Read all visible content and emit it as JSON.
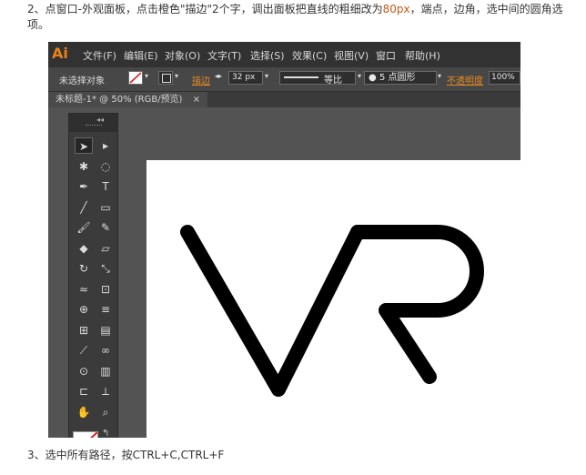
{
  "step1": {
    "text_a": "2、点窗口-外观面板，点击橙色\"描边\"2个字，调出面板把直线的粗细改为",
    "highlight": "80px",
    "text_b": "，端点，边角，选中间的圆角选项。"
  },
  "menubar": {
    "logo": "Ai",
    "items": [
      "文件(F)",
      "编辑(E)",
      "对象(O)",
      "文字(T)",
      "选择(S)",
      "效果(C)",
      "视图(V)",
      "窗口",
      "帮助(H)"
    ]
  },
  "controlbar": {
    "selection_label": "未选择对象",
    "stroke_label": "描边",
    "stroke_weight": "32 px",
    "profile_label": "等比",
    "brush_label": "5 点圆形",
    "opacity_label": "不透明度",
    "opacity_value": "100%"
  },
  "tab": {
    "title": "未标题-1* @ 50% (RGB/预览)",
    "close": "×"
  },
  "tools": [
    "selection-tool",
    "direct-selection-tool",
    "magic-wand-tool",
    "lasso-tool",
    "pen-tool",
    "type-tool",
    "line-tool",
    "rectangle-tool",
    "paintbrush-tool",
    "pencil-tool",
    "blob-brush-tool",
    "eraser-tool",
    "rotate-tool",
    "scale-tool",
    "warp-tool",
    "free-transform-tool",
    "shape-builder-tool",
    "graph-tool",
    "mesh-tool",
    "gradient-tool",
    "eyedropper-tool",
    "blend-tool",
    "symbol-sprayer-tool",
    "column-graph-tool",
    "artboard-tool",
    "slice-tool",
    "hand-tool",
    "zoom-tool"
  ],
  "artwork": {
    "stroke_color": "#000000",
    "artboard_color": "#ffffff"
  },
  "step3": {
    "text": "3、选中所有路径，按CTRL+C,CTRL+F"
  },
  "colors": {
    "accent": "#e88a1e",
    "workspace": "#535353"
  }
}
